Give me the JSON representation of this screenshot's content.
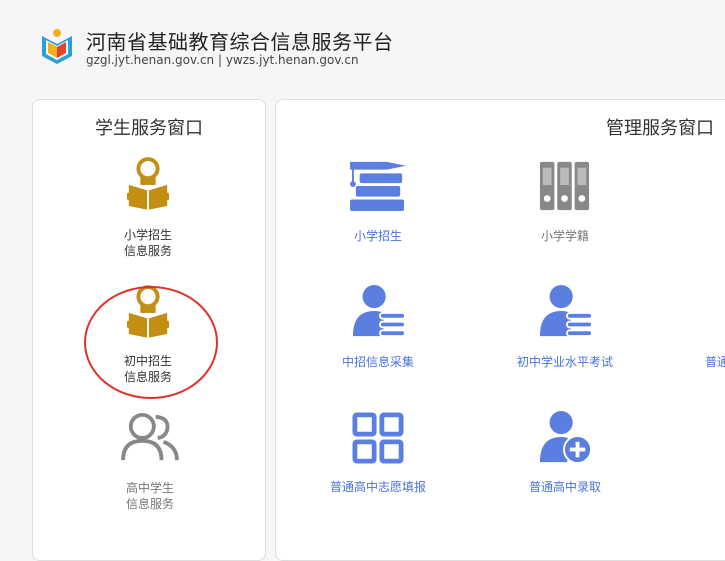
{
  "header": {
    "title": "河南省基础教育综合信息服务平台",
    "domains": "gzgl.jyt.henan.gov.cn | ywzs.jyt.henan.gov.cn"
  },
  "student_panel": {
    "title": "学生服务窗口",
    "items": [
      {
        "line1": "小学招生",
        "line2": "信息服务",
        "icon": "reading-student-icon"
      },
      {
        "line1": "初中招生",
        "line2": "信息服务",
        "icon": "reading-student-icon"
      },
      {
        "line1": "高中学生",
        "line2": "信息服务",
        "icon": "users-icon"
      }
    ]
  },
  "admin_panel": {
    "title": "管理服务窗口",
    "items": [
      {
        "label": "小学招生",
        "icon": "graduation-books-icon"
      },
      {
        "label": "小学学籍",
        "icon": "binders-icon"
      },
      {
        "label": "中招信息采集",
        "icon": "user-list-icon"
      },
      {
        "label": "初中学业水平考试",
        "icon": "user-list-icon"
      },
      {
        "label": "普通",
        "icon": "partial-icon"
      },
      {
        "label": "普通高中志愿填报",
        "icon": "grid-icon"
      },
      {
        "label": "普通高中录取",
        "icon": "user-add-icon"
      }
    ]
  },
  "colors": {
    "gold": "#c28f12",
    "blue": "#5b7fe1",
    "gray": "#888888",
    "highlight": "#e0322b"
  }
}
